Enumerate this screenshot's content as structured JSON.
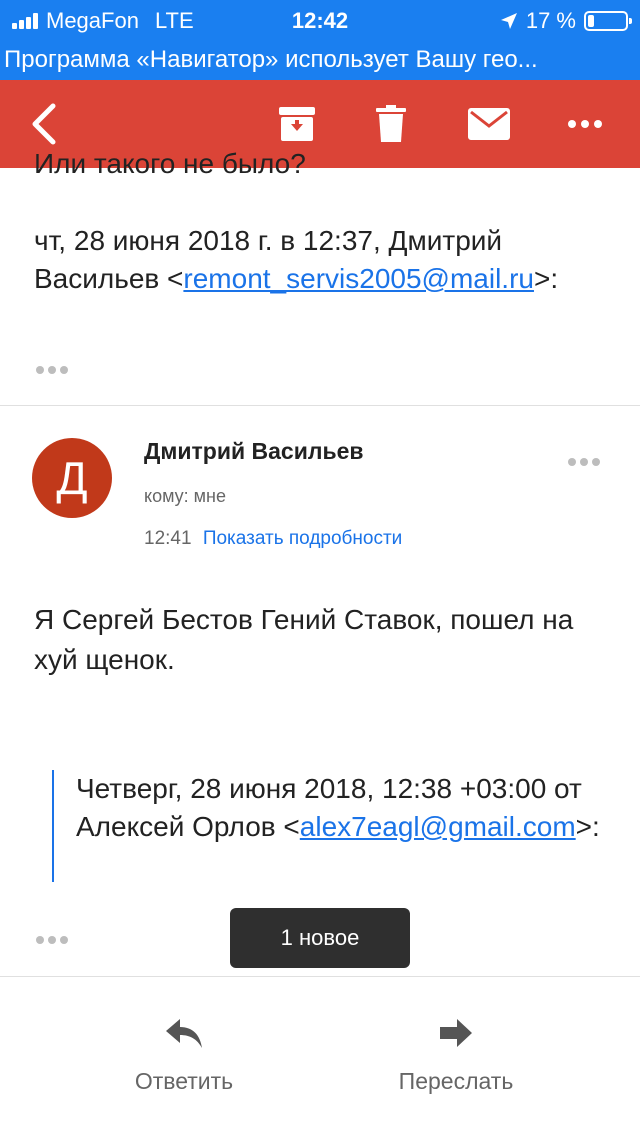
{
  "status_bar": {
    "carrier": "MegaFon",
    "network": "LTE",
    "time": "12:42",
    "battery_percent": "17 %",
    "battery_level": 0.17
  },
  "geo_banner": "Программа «Навигатор» использует Вашу гео...",
  "toolbar": {
    "icons": [
      "back-icon",
      "archive-icon",
      "trash-icon",
      "mail-icon",
      "more-icon"
    ],
    "color": "#db4437"
  },
  "prev_message": {
    "cut_line": "Или такого не было?",
    "header_text": "чт, 28 июня 2018 г. в 12:37, Дмитрий Васильев <",
    "email": "remont_servis2005@mail.ru",
    "header_suffix": ">:"
  },
  "message": {
    "avatar_letter": "Д",
    "sender": "Дмитрий Васильев",
    "recipient": "кому: мне",
    "time": "12:41",
    "details_link": "Показать подробности",
    "body": "Я Сергей Бестов Гений Ставок, пошел на хуй щенок.",
    "quote_text": "Четверг, 28 июня 2018, 12:38 +03:00 от Алексей Орлов <",
    "quote_email": "alex7eagl@gmail.com",
    "quote_suffix": ">:"
  },
  "new_pill": "1 новое",
  "bottom_actions": {
    "reply_label": "Ответить",
    "forward_label": "Переслать"
  },
  "colors": {
    "status_blue": "#1a7ff0",
    "toolbar_red": "#db4437",
    "link_blue": "#1a73e8",
    "avatar_red": "#c1391a"
  }
}
